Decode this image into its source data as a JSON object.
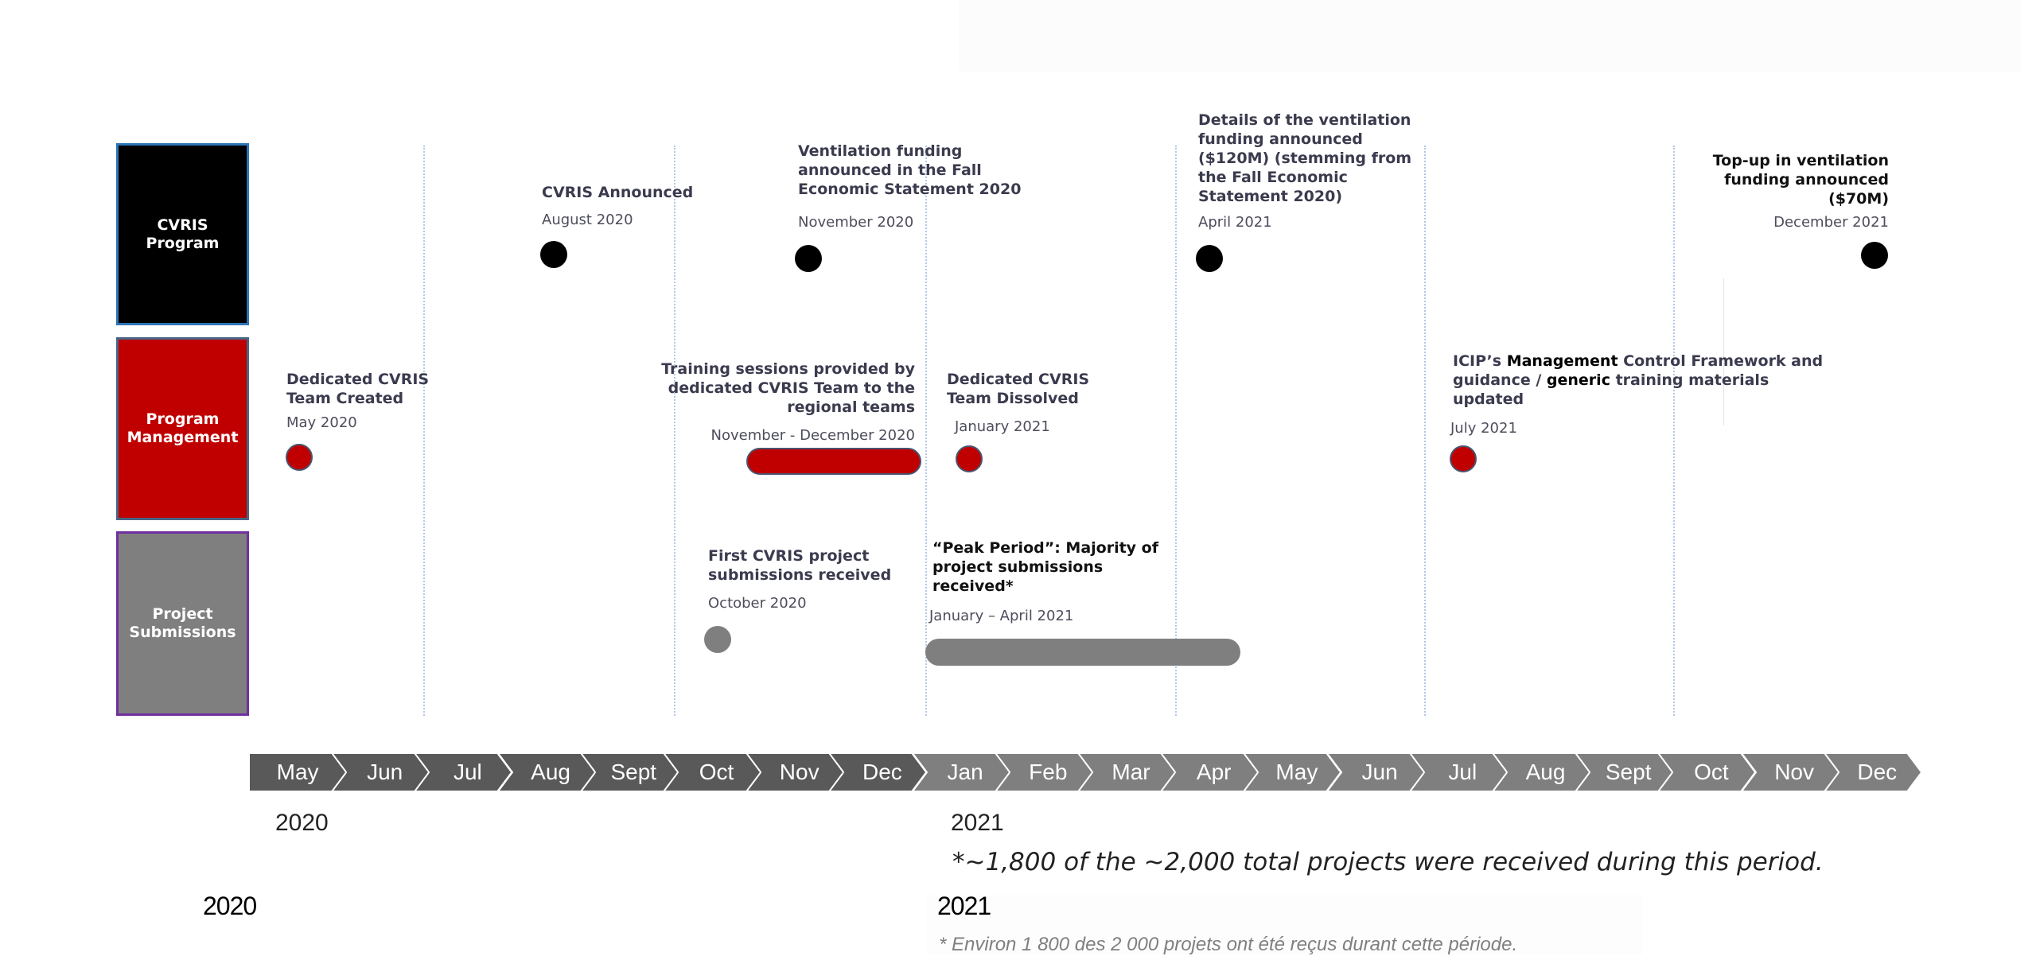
{
  "rows": [
    {
      "id": "cvris",
      "label_lines": [
        "CVRIS",
        "Program"
      ],
      "color": "#000000"
    },
    {
      "id": "pm",
      "label_lines": [
        "Program",
        "Management"
      ],
      "color": "#c00000"
    },
    {
      "id": "ps",
      "label_lines": [
        "Project",
        "Submissions"
      ],
      "color": "#7f7f7f"
    }
  ],
  "events": {
    "cvris_announced": {
      "title_lines": [
        "CVRIS Announced"
      ],
      "date": "August 2020",
      "row": "CVRIS Program",
      "month": "2020-08"
    },
    "ventilation_fes": {
      "title_lines": [
        "Ventilation funding",
        "announced in the Fall",
        "Economic Statement 2020"
      ],
      "date": "November 2020",
      "row": "CVRIS Program",
      "month": "2020-11"
    },
    "ventilation_details": {
      "title_lines": [
        "Details of the ventilation",
        "funding announced",
        "($120M) (stemming from",
        "the Fall Economic",
        "Statement 2020)"
      ],
      "date": "April 2021",
      "row": "CVRIS Program",
      "month": "2021-04"
    },
    "topup": {
      "title_lines": [
        "Top-up in ventilation",
        "funding announced",
        "($70M)"
      ],
      "date": "December 2021",
      "row": "CVRIS Program",
      "month": "2021-12"
    },
    "team_created": {
      "title_lines": [
        "Dedicated CVRIS",
        "Team Created"
      ],
      "date": "May 2020",
      "row": "Program Management",
      "month": "2020-05"
    },
    "training": {
      "title_lines": [
        "Training sessions provided by",
        "dedicated CVRIS Team to the",
        "regional teams"
      ],
      "date": "November - December 2020",
      "row": "Program Management",
      "start": "2020-11",
      "end": "2020-12"
    },
    "team_dissolved": {
      "title_lines": [
        "Dedicated CVRIS",
        "Team Dissolved"
      ],
      "date": "January 2021",
      "row": "Program Management",
      "month": "2021-01"
    },
    "icip": {
      "title_parts": [
        "ICIP’s ",
        "Management",
        " Control Framework and",
        "guidance / ",
        "generic",
        " training materials",
        "updated"
      ],
      "date": "July 2021",
      "row": "Program Management",
      "month": "2021-07"
    },
    "first_submissions": {
      "title_lines": [
        "First CVRIS project",
        "submissions received"
      ],
      "date": "October 2020",
      "row": "Project Submissions",
      "month": "2020-10"
    },
    "peak_period": {
      "title_lines": [
        "“Peak Period”: Majority of",
        "project submissions",
        "received*"
      ],
      "date": "January – April 2021",
      "row": "Project Submissions",
      "start": "2021-01",
      "end": "2021-04"
    }
  },
  "timeline": {
    "months": [
      "May",
      "Jun",
      "Jul",
      "Aug",
      "Sept",
      "Oct",
      "Nov",
      "Dec",
      "Jan",
      "Feb",
      "Mar",
      "Apr",
      "May",
      "Jun",
      "Jul",
      "Aug",
      "Sept",
      "Oct",
      "Nov",
      "Dec"
    ],
    "year_2020_label": "2020",
    "year_2021_label": "2021",
    "color_2020": "#595959",
    "color_2021": "#7f7f7f"
  },
  "footnote_en": "*~1,800 of the ~2,000 total projects were received during this period.",
  "lower_year_2020": "2020",
  "lower_year_2021": "2021",
  "footnote_fr": "* Environ 1 800 des 2 000 projets ont été reçus durant cette période."
}
